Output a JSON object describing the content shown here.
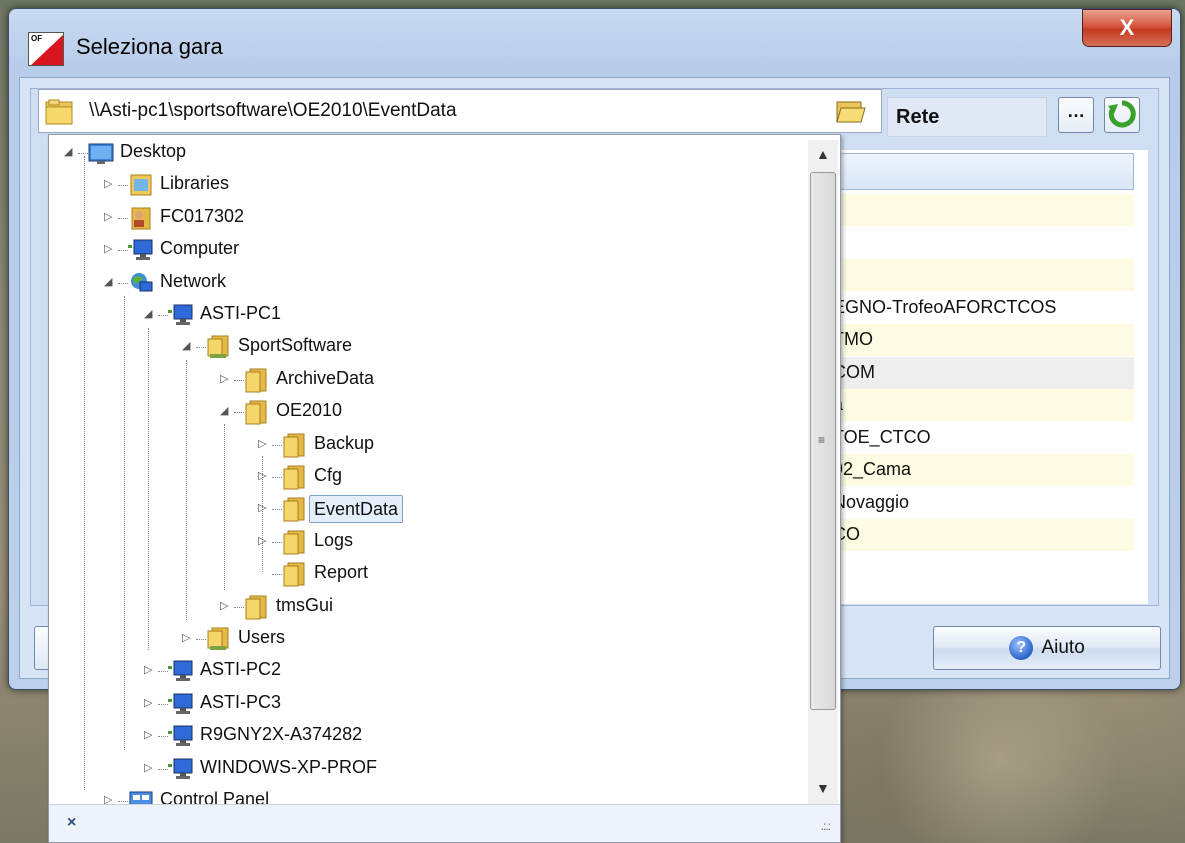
{
  "window": {
    "title": "Seleziona gara",
    "close_label": "X",
    "app_icon_label": "OF"
  },
  "path_bar": {
    "value": "\\\\Asti-pc1\\sportsoftware\\OE2010\\EventData",
    "location_label": "Rete",
    "browse_button": "…"
  },
  "list": {
    "rows": [
      "",
      "",
      "",
      "EGNO-TrofeoAFORCTCOS",
      "TMO",
      "COM",
      "a",
      "TOE_CTCO",
      "92_Cama",
      "Novaggio",
      "CO"
    ]
  },
  "buttons": {
    "help": "Aiuto",
    "help_icon": "?"
  },
  "tree": {
    "items": [
      {
        "label": "Desktop",
        "icon": "desktop-icon"
      },
      {
        "label": "Libraries",
        "icon": "libraries-icon"
      },
      {
        "label": "FC017302",
        "icon": "user-folder-icon"
      },
      {
        "label": "Computer",
        "icon": "computer-icon"
      },
      {
        "label": "Network",
        "icon": "network-icon"
      },
      {
        "label": "ASTI-PC1",
        "icon": "computer-icon"
      },
      {
        "label": "SportSoftware",
        "icon": "shared-folder-icon"
      },
      {
        "label": "ArchiveData",
        "icon": "folder-icon"
      },
      {
        "label": "OE2010",
        "icon": "folder-icon"
      },
      {
        "label": "Backup",
        "icon": "folder-icon"
      },
      {
        "label": "Cfg",
        "icon": "folder-icon"
      },
      {
        "label": "EventData",
        "icon": "folder-icon",
        "selected": true
      },
      {
        "label": "Logs",
        "icon": "folder-icon"
      },
      {
        "label": "Report",
        "icon": "folder-icon"
      },
      {
        "label": "tmsGui",
        "icon": "folder-icon"
      },
      {
        "label": "Users",
        "icon": "shared-folder-icon"
      },
      {
        "label": "ASTI-PC2",
        "icon": "computer-icon"
      },
      {
        "label": "ASTI-PC3",
        "icon": "computer-icon"
      },
      {
        "label": "R9GNY2X-A374282",
        "icon": "computer-icon"
      },
      {
        "label": "WINDOWS-XP-PROF",
        "icon": "computer-icon"
      },
      {
        "label": "Control Panel",
        "icon": "control-panel-icon"
      }
    ]
  },
  "status": {
    "close_symbol": "×"
  },
  "colors": {
    "selection_border": "#7da2ce",
    "row_alt": "#fdfbe2",
    "close_red": "#c23a1f"
  }
}
